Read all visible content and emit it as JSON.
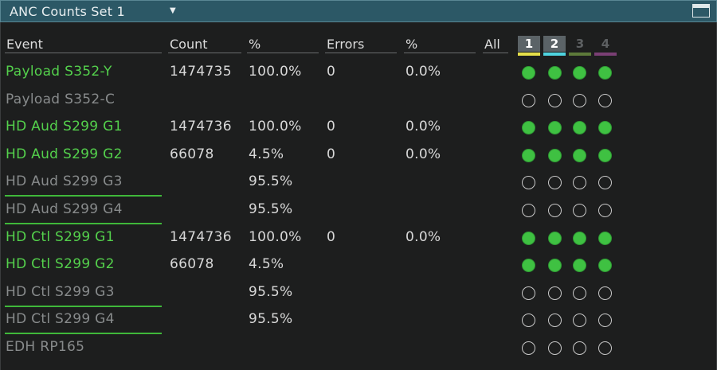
{
  "window": {
    "title": "ANC Counts Set 1"
  },
  "headers": {
    "event": "Event",
    "count": "Count",
    "pct1": "%",
    "errors": "Errors",
    "pct2": "%",
    "all": "All"
  },
  "channels": [
    {
      "label": "1",
      "active": true,
      "color": "#e6e04a"
    },
    {
      "label": "2",
      "active": true,
      "color": "#4fd4e0"
    },
    {
      "label": "3",
      "active": false,
      "color": "#5d7a3a"
    },
    {
      "label": "4",
      "active": false,
      "color": "#7a3f74"
    }
  ],
  "rows": [
    {
      "name": "Payload S352-Y",
      "active": true,
      "underline": false,
      "count": "1474735",
      "pct": "100.0%",
      "errors": "0",
      "err_pct": "0.0%",
      "dots": [
        true,
        true,
        true,
        true
      ]
    },
    {
      "name": "Payload S352-C",
      "active": false,
      "underline": false,
      "count": "",
      "pct": "",
      "errors": "",
      "err_pct": "",
      "dots": [
        false,
        false,
        false,
        false
      ]
    },
    {
      "name": "HD Aud S299 G1",
      "active": true,
      "underline": false,
      "count": "1474736",
      "pct": "100.0%",
      "errors": "0",
      "err_pct": "0.0%",
      "dots": [
        true,
        true,
        true,
        true
      ]
    },
    {
      "name": "HD Aud S299 G2",
      "active": true,
      "underline": false,
      "count": "66078",
      "pct": "4.5%",
      "errors": "0",
      "err_pct": "0.0%",
      "dots": [
        true,
        true,
        true,
        true
      ]
    },
    {
      "name": "HD Aud S299 G3",
      "active": false,
      "underline": true,
      "count": "",
      "pct": "95.5%",
      "errors": "",
      "err_pct": "",
      "dots": [
        false,
        false,
        false,
        false
      ]
    },
    {
      "name": "HD Aud S299 G4",
      "active": false,
      "underline": true,
      "count": "",
      "pct": "95.5%",
      "errors": "",
      "err_pct": "",
      "dots": [
        false,
        false,
        false,
        false
      ]
    },
    {
      "name": "HD Ctl S299 G1",
      "active": true,
      "underline": false,
      "count": "1474736",
      "pct": "100.0%",
      "errors": "0",
      "err_pct": "0.0%",
      "dots": [
        true,
        true,
        true,
        true
      ]
    },
    {
      "name": "HD Ctl S299 G2",
      "active": true,
      "underline": false,
      "count": "66078",
      "pct": "4.5%",
      "errors": "",
      "err_pct": "",
      "dots": [
        true,
        true,
        true,
        true
      ]
    },
    {
      "name": "HD Ctl S299 G3",
      "active": false,
      "underline": true,
      "count": "",
      "pct": "95.5%",
      "errors": "",
      "err_pct": "",
      "dots": [
        false,
        false,
        false,
        false
      ]
    },
    {
      "name": "HD Ctl S299 G4",
      "active": false,
      "underline": true,
      "count": "",
      "pct": "95.5%",
      "errors": "",
      "err_pct": "",
      "dots": [
        false,
        false,
        false,
        false
      ]
    },
    {
      "name": "EDH RP165",
      "active": false,
      "underline": false,
      "count": "",
      "pct": "",
      "errors": "",
      "err_pct": "",
      "dots": [
        false,
        false,
        false,
        false
      ]
    }
  ]
}
